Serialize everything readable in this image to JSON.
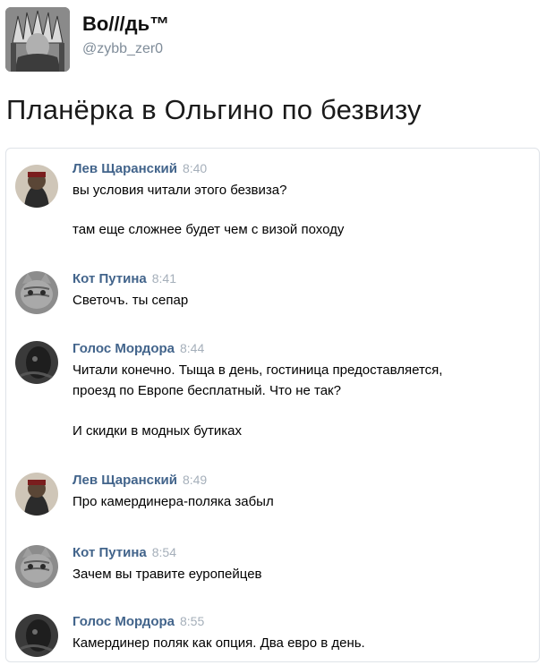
{
  "author": {
    "name": "Во///дь™",
    "handle": "@zybb_zer0"
  },
  "tweet": {
    "text": "Планёрка в Ольгино по безвизу"
  },
  "messages": [
    {
      "user": "Лев Щаранский",
      "time": "8:40",
      "lines": [
        "вы условия читали этого безвиза?",
        "там еще сложнее будет чем с визой походу"
      ]
    },
    {
      "user": "Кот Путина",
      "time": "8:41",
      "lines": [
        "Светочъ. ты сепар"
      ]
    },
    {
      "user": "Голос Мордора",
      "time": "8:44",
      "lines": [
        "Читали конечно. Тыща в день, гостиница предоставляется,",
        "проезд по Европе бесплатный. Что не так?",
        "И скидки в модных бутиках"
      ]
    },
    {
      "user": "Лев Щаранский",
      "time": "8:49",
      "lines": [
        "Про камердинера-поляка забыл"
      ]
    },
    {
      "user": "Кот Путина",
      "time": "8:54",
      "lines": [
        "Зачем вы травите еуропейцев"
      ]
    },
    {
      "user": "Голос Мордора",
      "time": "8:55",
      "lines": [
        "Камердинер поляк как опция. Два евро в день."
      ]
    }
  ]
}
